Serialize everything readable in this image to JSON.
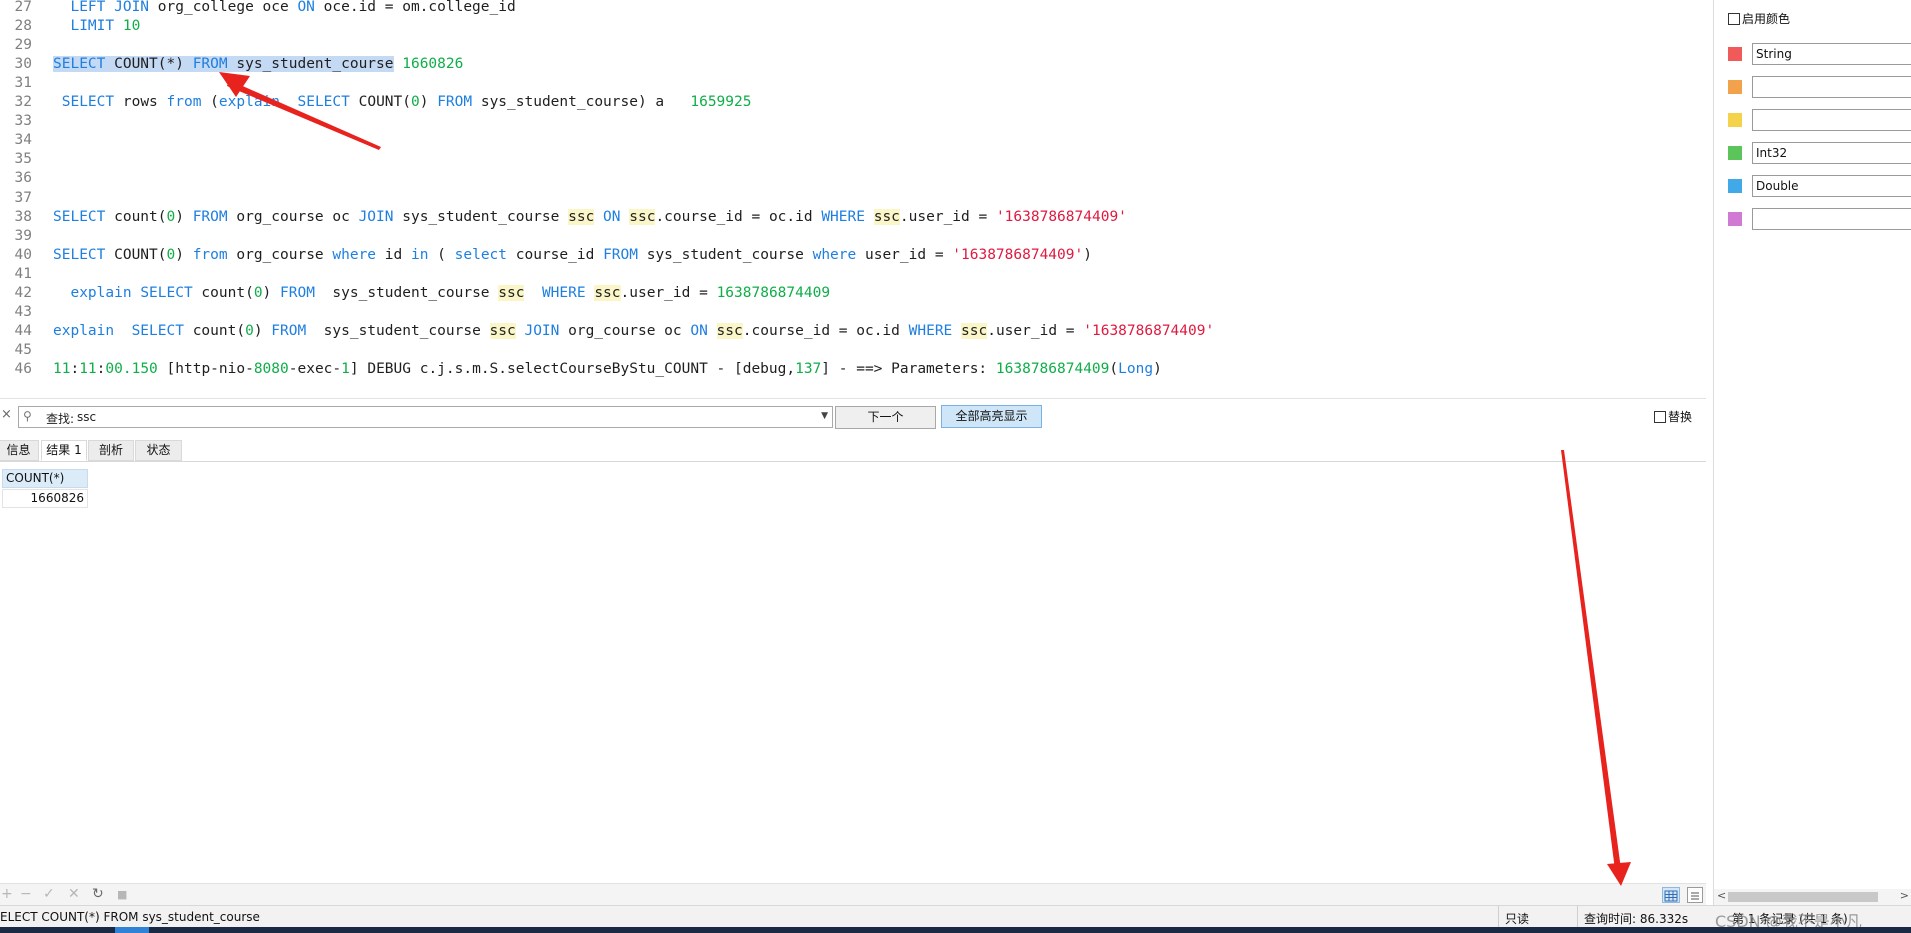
{
  "editor": {
    "lines": [
      {
        "num": "27",
        "tokens": [
          {
            "t": "  "
          },
          {
            "t": "LEFT JOIN",
            "c": "k"
          },
          {
            "t": " org_college oce "
          },
          {
            "t": "ON",
            "c": "k"
          },
          {
            "t": " oce.id = om.college_id"
          }
        ]
      },
      {
        "num": "28",
        "tokens": [
          {
            "t": "  "
          },
          {
            "t": "LIMIT",
            "c": "k"
          },
          {
            "t": " "
          },
          {
            "t": "10",
            "c": "n"
          }
        ]
      },
      {
        "num": "29",
        "tokens": []
      },
      {
        "num": "30",
        "tokens": [
          {
            "t": "SELECT",
            "c": "k sel"
          },
          {
            "t": " COUNT(*) ",
            "c": "sel"
          },
          {
            "t": "FROM",
            "c": "k sel"
          },
          {
            "t": " sys_student_course",
            "c": "sel"
          },
          {
            "t": " "
          },
          {
            "t": "1660826",
            "c": "n"
          }
        ]
      },
      {
        "num": "31",
        "tokens": []
      },
      {
        "num": "32",
        "tokens": [
          {
            "t": " "
          },
          {
            "t": "SELECT",
            "c": "k"
          },
          {
            "t": " rows "
          },
          {
            "t": "from",
            "c": "k"
          },
          {
            "t": " ("
          },
          {
            "t": "explain",
            "c": "k"
          },
          {
            "t": "  "
          },
          {
            "t": "SELECT",
            "c": "k"
          },
          {
            "t": " COUNT("
          },
          {
            "t": "0",
            "c": "n"
          },
          {
            "t": ") "
          },
          {
            "t": "FROM",
            "c": "k"
          },
          {
            "t": " sys_student_course) a   "
          },
          {
            "t": "1659925",
            "c": "n"
          }
        ]
      },
      {
        "num": "33",
        "tokens": []
      },
      {
        "num": "34",
        "tokens": []
      },
      {
        "num": "35",
        "tokens": []
      },
      {
        "num": "36",
        "tokens": []
      },
      {
        "num": "37",
        "tokens": []
      },
      {
        "num": "38",
        "tokens": [
          {
            "t": "SELECT",
            "c": "k"
          },
          {
            "t": " count("
          },
          {
            "t": "0",
            "c": "n"
          },
          {
            "t": ") "
          },
          {
            "t": "FROM",
            "c": "k"
          },
          {
            "t": " org_course oc "
          },
          {
            "t": "JOIN",
            "c": "k"
          },
          {
            "t": " sys_student_course "
          },
          {
            "t": "ssc",
            "c": "h"
          },
          {
            "t": " "
          },
          {
            "t": "ON",
            "c": "k"
          },
          {
            "t": " "
          },
          {
            "t": "ssc",
            "c": "h"
          },
          {
            "t": ".course_id = oc.id "
          },
          {
            "t": "WHERE",
            "c": "k"
          },
          {
            "t": " "
          },
          {
            "t": "ssc",
            "c": "h"
          },
          {
            "t": ".user_id = "
          },
          {
            "t": "'1638786874409'",
            "c": "s"
          }
        ]
      },
      {
        "num": "39",
        "tokens": []
      },
      {
        "num": "40",
        "tokens": [
          {
            "t": "SELECT",
            "c": "k"
          },
          {
            "t": " COUNT("
          },
          {
            "t": "0",
            "c": "n"
          },
          {
            "t": ") "
          },
          {
            "t": "from",
            "c": "k"
          },
          {
            "t": " org_course "
          },
          {
            "t": "where",
            "c": "k"
          },
          {
            "t": " id "
          },
          {
            "t": "in",
            "c": "k"
          },
          {
            "t": " ( "
          },
          {
            "t": "select",
            "c": "k"
          },
          {
            "t": " course_id "
          },
          {
            "t": "FROM",
            "c": "k"
          },
          {
            "t": " sys_student_course "
          },
          {
            "t": "where",
            "c": "k"
          },
          {
            "t": " user_id = "
          },
          {
            "t": "'1638786874409'",
            "c": "s"
          },
          {
            "t": ")"
          }
        ]
      },
      {
        "num": "41",
        "tokens": []
      },
      {
        "num": "42",
        "tokens": [
          {
            "t": "  "
          },
          {
            "t": "explain",
            "c": "k"
          },
          {
            "t": " "
          },
          {
            "t": "SELECT",
            "c": "k"
          },
          {
            "t": " count("
          },
          {
            "t": "0",
            "c": "n"
          },
          {
            "t": ") "
          },
          {
            "t": "FROM",
            "c": "k"
          },
          {
            "t": "  sys_student_course "
          },
          {
            "t": "ssc",
            "c": "h"
          },
          {
            "t": "  "
          },
          {
            "t": "WHERE",
            "c": "k"
          },
          {
            "t": " "
          },
          {
            "t": "ssc",
            "c": "h"
          },
          {
            "t": ".user_id = "
          },
          {
            "t": "1638786874409",
            "c": "n"
          }
        ]
      },
      {
        "num": "43",
        "tokens": []
      },
      {
        "num": "44",
        "tokens": [
          {
            "t": "explain",
            "c": "k"
          },
          {
            "t": "  "
          },
          {
            "t": "SELECT",
            "c": "k"
          },
          {
            "t": " count("
          },
          {
            "t": "0",
            "c": "n"
          },
          {
            "t": ") "
          },
          {
            "t": "FROM",
            "c": "k"
          },
          {
            "t": "  sys_student_course "
          },
          {
            "t": "ssc",
            "c": "h"
          },
          {
            "t": " "
          },
          {
            "t": "JOIN",
            "c": "k"
          },
          {
            "t": " org_course oc "
          },
          {
            "t": "ON",
            "c": "k"
          },
          {
            "t": " "
          },
          {
            "t": "ssc",
            "c": "h"
          },
          {
            "t": ".course_id = oc.id "
          },
          {
            "t": "WHERE",
            "c": "k"
          },
          {
            "t": " "
          },
          {
            "t": "ssc",
            "c": "h"
          },
          {
            "t": ".user_id = "
          },
          {
            "t": "'1638786874409'",
            "c": "s"
          }
        ]
      },
      {
        "num": "45",
        "tokens": []
      },
      {
        "num": "46",
        "tokens": [
          {
            "t": "11",
            "c": "n"
          },
          {
            "t": ":"
          },
          {
            "t": "11",
            "c": "n"
          },
          {
            "t": ":"
          },
          {
            "t": "00.150",
            "c": "n"
          },
          {
            "t": " [http-nio-"
          },
          {
            "t": "8080",
            "c": "n"
          },
          {
            "t": "-exec-"
          },
          {
            "t": "1",
            "c": "n"
          },
          {
            "t": "] DEBUG c.j.s.m.S.selectCourseByStu_COUNT - [debug,"
          },
          {
            "t": "137",
            "c": "n"
          },
          {
            "t": "] - ==> Parameters: "
          },
          {
            "t": "1638786874409",
            "c": "n"
          },
          {
            "t": "("
          },
          {
            "t": "Long",
            "c": "k"
          },
          {
            "t": ")"
          }
        ]
      }
    ]
  },
  "findbar": {
    "close": "×",
    "icon": "search-icon",
    "prefix": "查找:",
    "value": "ssc",
    "next_label": "下一个",
    "highlight_all_label": "全部高亮显示",
    "replace_label": "替换"
  },
  "tabs": [
    {
      "label": "信息",
      "active": false
    },
    {
      "label": "结果 1",
      "active": true
    },
    {
      "label": "剖析",
      "active": false
    },
    {
      "label": "状态",
      "active": false
    }
  ],
  "result": {
    "columns": [
      "COUNT(*)"
    ],
    "rows": [
      [
        "1660826"
      ]
    ]
  },
  "toolbar": {
    "icons": [
      "add-icon",
      "remove-icon",
      "apply-icon",
      "discard-icon",
      "refresh-icon",
      "stop-icon"
    ],
    "glyphs": [
      "+",
      "−",
      "✓",
      "✕",
      "↻",
      "■"
    ]
  },
  "statusbar": {
    "sql": "ELECT COUNT(*) FROM sys_student_course",
    "readonly": "只读",
    "query_time": "查询时间: 86.332s",
    "records": "第 1 条记录 (共 1 条)",
    "watermark": "CSDN @我不是小凡"
  },
  "rightpanel": {
    "enable_color_label": "启用颜色",
    "rows": [
      {
        "color": "#f05a5a",
        "value": "String"
      },
      {
        "color": "#f2a24a",
        "value": ""
      },
      {
        "color": "#f4d24a",
        "value": ""
      },
      {
        "color": "#5bc45b",
        "value": "Int32"
      },
      {
        "color": "#42a9e8",
        "value": "Double"
      },
      {
        "color": "#d07ad4",
        "value": ""
      }
    ]
  },
  "colors": {
    "keyword": "#1e7fe0",
    "number": "#0fae48",
    "string": "#e0193f",
    "match_highlight": "#fbf6c8",
    "selection": "#c4d9f3",
    "annotation_arrow": "#e8231e"
  }
}
